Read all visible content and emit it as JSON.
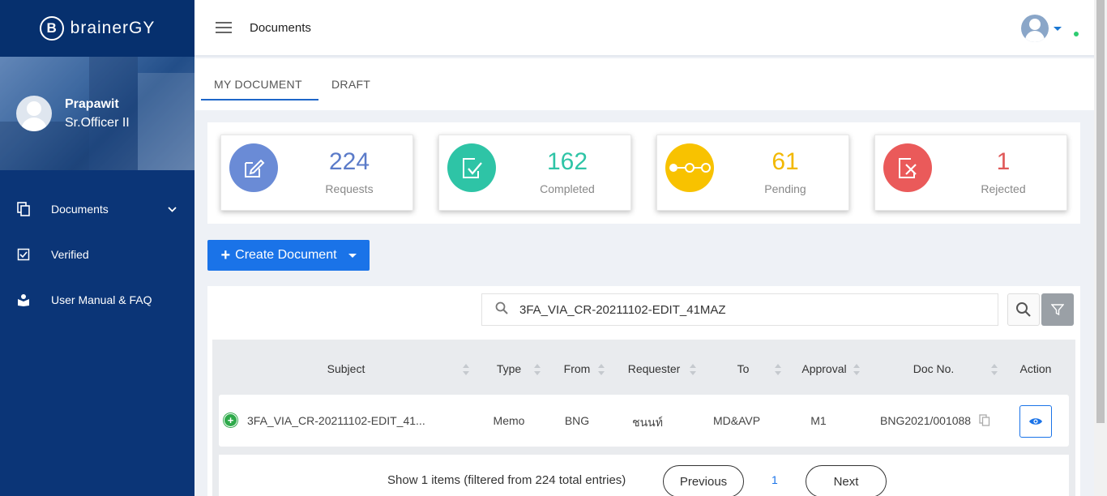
{
  "app": {
    "logo_text": "brainerGY"
  },
  "profile": {
    "name": "Prapawit",
    "role": "Sr.Officer II"
  },
  "sidebar": {
    "items": [
      {
        "label": "Documents",
        "icon": "copy-icon",
        "expandable": true
      },
      {
        "label": "Verified",
        "icon": "checkbox-icon"
      },
      {
        "label": "User Manual & FAQ",
        "icon": "reader-icon"
      }
    ]
  },
  "topbar": {
    "title": "Documents"
  },
  "tabs": [
    {
      "label": "MY DOCUMENT",
      "active": true
    },
    {
      "label": "DRAFT"
    }
  ],
  "stats": [
    {
      "value": "224",
      "label": "Requests",
      "color": "#6a8bd6",
      "icon": "edit-icon"
    },
    {
      "value": "162",
      "label": "Completed",
      "color": "#2ec4a6",
      "icon": "check-doc-icon"
    },
    {
      "value": "61",
      "label": "Pending",
      "color": "#f8c200",
      "icon": "pending-dots-icon"
    },
    {
      "value": "1",
      "label": "Rejected",
      "color": "#ea5a5a",
      "icon": "reject-doc-icon"
    }
  ],
  "create_button": {
    "label": "Create Document"
  },
  "search": {
    "value": "3FA_VIA_CR-20211102-EDIT_41MAZ"
  },
  "table": {
    "columns": [
      "Subject",
      "Type",
      "From",
      "Requester",
      "To",
      "Approval",
      "Doc No.",
      "Action"
    ],
    "rows": [
      {
        "subject": "3FA_VIA_CR-20211102-EDIT_41...",
        "type": "Memo",
        "from": "BNG",
        "requester": "ชนนท์",
        "to": "MD&AVP",
        "approval": "M1",
        "doc_no": "BNG2021/001088"
      }
    ]
  },
  "pagination": {
    "info": "Show 1 items (filtered from 224 total entries)",
    "previous": "Previous",
    "page": "1",
    "next": "Next"
  }
}
